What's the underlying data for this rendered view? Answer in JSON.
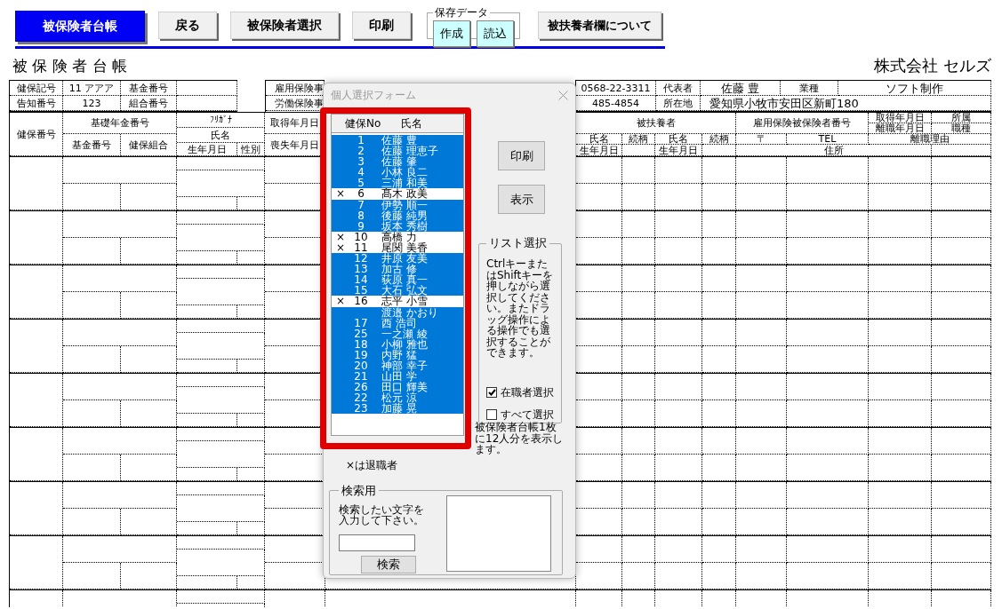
{
  "toolbar": {
    "buttons": [
      {
        "label": "被保険者台帳",
        "kind": "primary"
      },
      {
        "label": "戻る",
        "kind": "plain"
      },
      {
        "label": "被保険者選択",
        "kind": "plain"
      },
      {
        "label": "印刷",
        "kind": "plain"
      }
    ],
    "save_group": {
      "title": "保存データ",
      "buttons": [
        "作成",
        "読込"
      ]
    },
    "extra_button": "被扶養者欄について"
  },
  "sheet": {
    "title": "被 保 険 者 台 帳",
    "company": "株式会社 セルズ",
    "info_left": [
      {
        "label": "健保記号",
        "value": "11 アアア",
        "label2": "基金番号"
      },
      {
        "label": "告知番号",
        "value": "123",
        "label2": "組合番号"
      }
    ],
    "office_labels": [
      "雇用保険事",
      "労働保険事"
    ],
    "info_right": [
      {
        "value": "0568-22-3311",
        "label": "代表者",
        "value2": "佐藤 豊",
        "label2": "業種",
        "value3": "ソフト制作"
      },
      {
        "value": "485-4854",
        "label": "所在地",
        "value2": "愛知県小牧市安田区新町180"
      }
    ],
    "headers_left": [
      "健保番号",
      "基礎年金番号",
      "基金番号",
      "健保組合",
      "ﾌﾘｶﾞﾅ",
      "氏名",
      "生年月日",
      "性別",
      "取得年月日",
      "喪失年月日"
    ],
    "headers_right": [
      "被扶養者",
      "雇用保険被保険者番号",
      "取得年月日",
      "所属",
      "離職年月日",
      "職種",
      "氏名",
      "続柄",
      "氏名",
      "続柄",
      "〒",
      "TEL",
      "離職理由",
      "生年月日",
      "生年月日",
      "住所"
    ]
  },
  "dialog": {
    "title": "個人選択フォーム",
    "list_headers": [
      "健保No",
      "氏名"
    ],
    "items": [
      {
        "no": "1",
        "name": "佐藤 豊",
        "selected": true
      },
      {
        "no": "2",
        "name": "佐藤 理恵子",
        "selected": true
      },
      {
        "no": "3",
        "name": "佐藤 肇",
        "selected": true
      },
      {
        "no": "4",
        "name": "小林 良二",
        "selected": true
      },
      {
        "no": "5",
        "name": "三浦 和美",
        "selected": true
      },
      {
        "mark": "×",
        "no": "6",
        "name": "髙木 政美",
        "selected": false
      },
      {
        "no": "7",
        "name": "伊勢 順一",
        "selected": true
      },
      {
        "no": "8",
        "name": "後藤 純男",
        "selected": true
      },
      {
        "no": "9",
        "name": "坂本 秀樹",
        "selected": true
      },
      {
        "mark": "×",
        "no": "10",
        "name": "高橋 力",
        "selected": false
      },
      {
        "mark": "×",
        "no": "11",
        "name": "尾関 美香",
        "selected": false
      },
      {
        "no": "12",
        "name": "井原 友美",
        "selected": true
      },
      {
        "no": "13",
        "name": "加古 修",
        "selected": true
      },
      {
        "no": "14",
        "name": "荻原 真一",
        "selected": true
      },
      {
        "no": "15",
        "name": "大石 弘文",
        "selected": true
      },
      {
        "mark": "×",
        "no": "16",
        "name": "志平 小雪",
        "selected": false
      },
      {
        "name": "渡邉 かおり",
        "selected": true
      },
      {
        "no": "17",
        "name": "西 浩司",
        "selected": true
      },
      {
        "no": "25",
        "name": "一之瀬 綾",
        "selected": true
      },
      {
        "no": "18",
        "name": "小柳 雅也",
        "selected": true
      },
      {
        "no": "19",
        "name": "内野 猛",
        "selected": true
      },
      {
        "no": "20",
        "name": "神部 幸子",
        "selected": true
      },
      {
        "no": "21",
        "name": "山田 学",
        "selected": true
      },
      {
        "no": "26",
        "name": "田口 輝美",
        "selected": true
      },
      {
        "no": "22",
        "name": "松元 涼",
        "selected": true
      },
      {
        "no": "23",
        "name": "加藤 晃",
        "selected": true
      }
    ],
    "buttons": [
      "印刷",
      "表示"
    ],
    "list_select": {
      "title": "リスト選択",
      "help": "CtrlキーまたはShiftキーを押しながら選択してください。またドラッグ操作による操作でも選択することができます。",
      "options": [
        {
          "label": "在職者選択",
          "checked": true
        },
        {
          "label": "すべて選択",
          "checked": false
        }
      ]
    },
    "note": "被保険者台帳1枚に12人分を表示します。",
    "legend": "×は退職者",
    "search": {
      "title": "検索用",
      "prompt": "検索したい文字を入力して下さい。",
      "button": "検索"
    }
  }
}
